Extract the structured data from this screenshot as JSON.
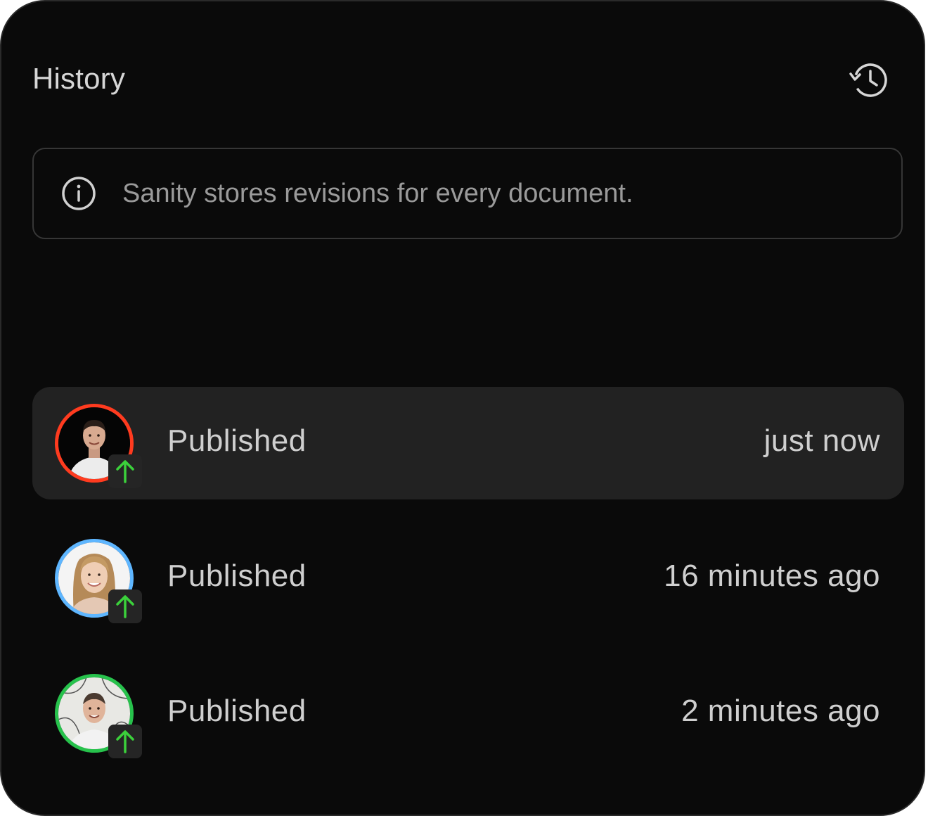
{
  "panel": {
    "title": "History",
    "history_icon": "history-clock-icon"
  },
  "notice": {
    "icon": "info-icon",
    "text": "Sanity stores revisions for every document."
  },
  "revisions": [
    {
      "label": "Published",
      "time": "just now",
      "ring_color": "#ff3b1f",
      "status_icon": "arrow-up-icon",
      "active": true
    },
    {
      "label": "Published",
      "time": "16 minutes ago",
      "ring_color": "#5eb6ff",
      "status_icon": "arrow-up-icon",
      "active": false
    },
    {
      "label": "Published",
      "time": "2 minutes ago",
      "ring_color": "#27c24c",
      "status_icon": "arrow-up-icon",
      "active": false
    }
  ],
  "colors": {
    "background": "#0a0a0a",
    "badge_arrow": "#3bd13b"
  }
}
